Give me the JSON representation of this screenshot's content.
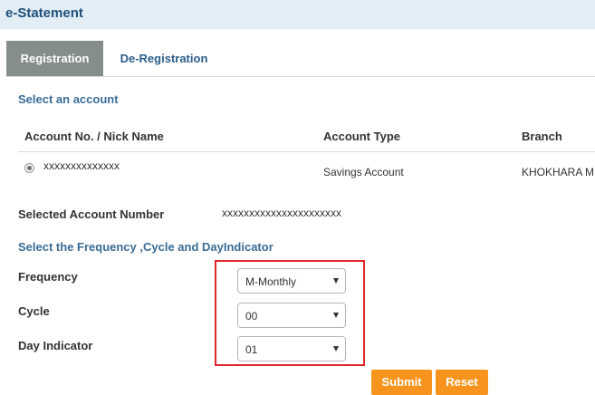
{
  "header": {
    "title": "e-Statement"
  },
  "tabs": [
    {
      "label": "Registration",
      "active": true
    },
    {
      "label": "De-Registration",
      "active": false
    }
  ],
  "account_section": {
    "title": "Select an account",
    "columns": [
      "Account No. / Nick Name",
      "Account Type",
      "Branch"
    ],
    "rows": [
      {
        "selected": true,
        "account": "xxxxxxxxxxxxxx",
        "type": "Savings Account",
        "branch": "KHOKHARA M"
      }
    ]
  },
  "selected_account": {
    "label": "Selected Account Number",
    "value": "xxxxxxxxxxxxxxxxxxxxxx"
  },
  "frequency_section": {
    "title": "Select the Frequency ,Cycle and DayIndicator",
    "frequency": {
      "label": "Frequency",
      "value": "M-Monthly"
    },
    "cycle": {
      "label": "Cycle",
      "value": "00"
    },
    "day_indicator": {
      "label": "Day Indicator",
      "value": "01"
    }
  },
  "buttons": {
    "submit": "Submit",
    "reset": "Reset"
  },
  "colors": {
    "header_bg": "#e3edf5",
    "active_tab_bg": "#868d8d",
    "link_blue": "#2c5f8a",
    "button_orange": "#f7941d",
    "highlight_red": "#e0262b"
  }
}
